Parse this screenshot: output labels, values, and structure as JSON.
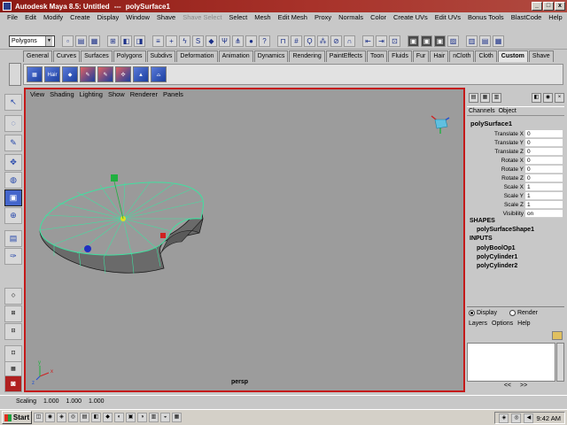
{
  "window": {
    "app_title": "Autodesk Maya 8.5: Untitled",
    "separator": "---",
    "object_title": "polySurface1",
    "buttons": [
      "_",
      "□",
      "x"
    ]
  },
  "menubar": {
    "items": [
      "File",
      "Edit",
      "Modify",
      "Create",
      "Display",
      "Window",
      "Shave",
      "Shave Select",
      "Select",
      "Mesh",
      "Edit Mesh",
      "Proxy",
      "Normals",
      "Color",
      "Create UVs",
      "Edit UVs",
      "Bonus Tools",
      "BlastCode",
      "Help"
    ],
    "disabled_index": 7
  },
  "statusline": {
    "mode": "Polygons"
  },
  "shelf": {
    "tabs": [
      "General",
      "Curves",
      "Surfaces",
      "Polygons",
      "Subdivs",
      "Deformation",
      "Animation",
      "Dynamics",
      "Rendering",
      "PaintEffects",
      "Toon",
      "Fluids",
      "Fur",
      "Hair",
      "nCloth",
      "Cloth",
      "Custom",
      "Shave"
    ],
    "active_tab": "Custom",
    "icon_hair_label": "Hair"
  },
  "viewport": {
    "menu": [
      "View",
      "Shading",
      "Lighting",
      "Show",
      "Renderer",
      "Panels"
    ],
    "camera_label": "persp",
    "axis_labels": {
      "x": "x",
      "y": "y",
      "z": "z"
    }
  },
  "channel_box": {
    "menu": [
      "Channels",
      "Object"
    ],
    "object_name": "polySurface1",
    "attributes": [
      {
        "name": "Translate X",
        "value": "0"
      },
      {
        "name": "Translate Y",
        "value": "0"
      },
      {
        "name": "Translate Z",
        "value": "0"
      },
      {
        "name": "Rotate X",
        "value": "0"
      },
      {
        "name": "Rotate Y",
        "value": "0"
      },
      {
        "name": "Rotate Z",
        "value": "0"
      },
      {
        "name": "Scale X",
        "value": "1"
      },
      {
        "name": "Scale Y",
        "value": "1"
      },
      {
        "name": "Scale Z",
        "value": "1"
      },
      {
        "name": "Visibility",
        "value": "on"
      }
    ],
    "shapes_header": "SHAPES",
    "shapes": [
      "polySurfaceShape1"
    ],
    "inputs_header": "INPUTS",
    "inputs": [
      "polyBoolOp1",
      "polyCylinder1",
      "polyCylinder2"
    ]
  },
  "layer_editor": {
    "display_label": "Display",
    "render_label": "Render",
    "menu": [
      "Layers",
      "Options",
      "Help"
    ],
    "range_arrows": [
      "<<",
      ">>"
    ]
  },
  "helpline": {
    "label": "Scaling",
    "values": [
      "1.000",
      "1.000",
      "1.000"
    ]
  },
  "taskbar": {
    "start_label": "Start",
    "clock": "9:42 AM"
  }
}
